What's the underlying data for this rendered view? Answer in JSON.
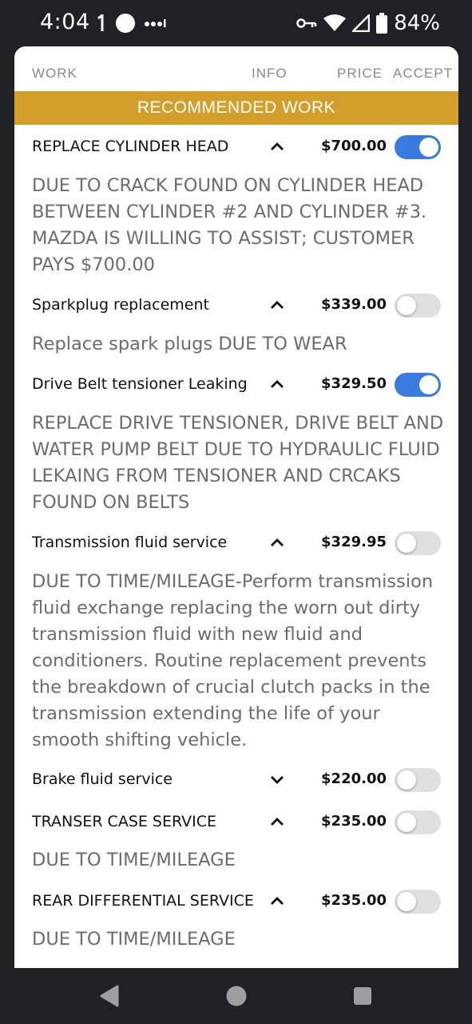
{
  "status": {
    "time": "4:04",
    "battery": "84%"
  },
  "columns": {
    "work": "WORK",
    "info": "INFO",
    "price": "PRICE",
    "accept": "ACCEPT"
  },
  "section": {
    "title": "RECOMMENDED WORK"
  },
  "items": [
    {
      "title": "REPLACE CYLINDER HEAD",
      "price": "$700.00",
      "expanded": true,
      "accepted": true,
      "description": "DUE TO CRACK FOUND ON CYLINDER HEAD BETWEEN CYLINDER #2 AND CYLINDER #3. MAZDA IS WILLING TO ASSIST; CUSTOMER PAYS $700.00"
    },
    {
      "title": "Sparkplug replacement",
      "price": "$339.00",
      "expanded": true,
      "accepted": false,
      "description": "Replace spark plugs DUE TO WEAR"
    },
    {
      "title": "Drive Belt tensioner Leaking",
      "price": "$329.50",
      "expanded": true,
      "accepted": true,
      "description": "REPLACE DRIVE TENSIONER, DRIVE BELT AND WATER PUMP BELT DUE TO HYDRAULIC FLUID LEKAING FROM TENSIONER AND CRCAKS FOUND ON BELTS"
    },
    {
      "title": "Transmission fluid service",
      "price": "$329.95",
      "expanded": true,
      "accepted": false,
      "description": "DUE TO TIME/MILEAGE-Perform transmission fluid exchange replacing the worn out dirty transmission fluid with new fluid and conditioners. Routine replacement prevents the breakdown of crucial clutch packs in the transmission extending the life of your smooth shifting vehicle."
    },
    {
      "title": "Brake fluid service",
      "price": "$220.00",
      "expanded": false,
      "accepted": false,
      "description": ""
    },
    {
      "title": "TRANSER CASE SERVICE",
      "price": "$235.00",
      "expanded": true,
      "accepted": false,
      "description": "DUE TO TIME/MILEAGE"
    },
    {
      "title": "REAR DIFFERENTIAL SERVICE",
      "price": "$235.00",
      "expanded": true,
      "accepted": false,
      "description": "DUE TO TIME/MILEAGE"
    }
  ],
  "colors": {
    "banner": "#d39f2a",
    "toggle_on": "#3a7be0",
    "toggle_off": "#e0e0e0",
    "description_text": "#6c6c6c"
  },
  "icons": {
    "expanded": "chevron-up-icon",
    "collapsed": "chevron-down-icon"
  }
}
